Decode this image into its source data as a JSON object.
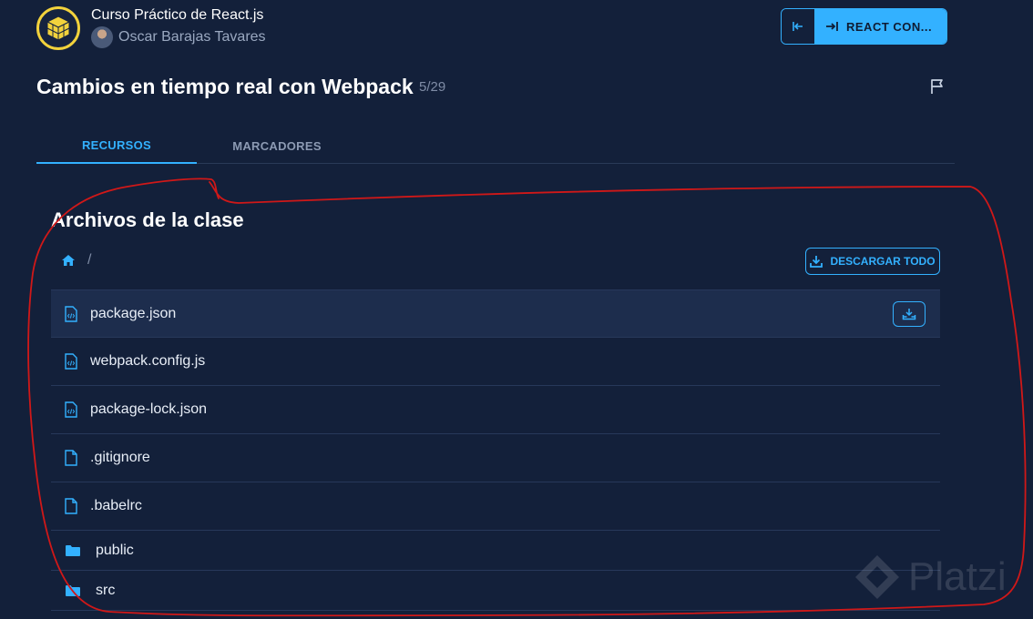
{
  "header": {
    "course_title": "Curso Práctico de React.js",
    "teacher_name": "Oscar Barajas Tavares",
    "next_label": "REACT CON..."
  },
  "lesson": {
    "title": "Cambios en tiempo real con Webpack",
    "counter": "5/29"
  },
  "tabs": [
    {
      "label": "RECURSOS",
      "active": true
    },
    {
      "label": "MARCADORES",
      "active": false
    }
  ],
  "files_section": {
    "title": "Archivos de la clase",
    "breadcrumb_separator": "/",
    "download_all_label": "DESCARGAR TODO",
    "items": [
      {
        "name": "package.json",
        "icon": "code-file-icon"
      },
      {
        "name": "webpack.config.js",
        "icon": "code-file-icon"
      },
      {
        "name": "package-lock.json",
        "icon": "code-file-icon"
      },
      {
        "name": ".gitignore",
        "icon": "file-icon"
      },
      {
        "name": ".babelrc",
        "icon": "file-icon"
      },
      {
        "name": "public",
        "icon": "folder-icon"
      },
      {
        "name": "src",
        "icon": "folder-icon"
      }
    ]
  },
  "watermark": "Platzi",
  "colors": {
    "background": "#13203a",
    "accent": "#33b1ff",
    "logo_ring": "#f2d23c",
    "annotation": "#d01818"
  }
}
